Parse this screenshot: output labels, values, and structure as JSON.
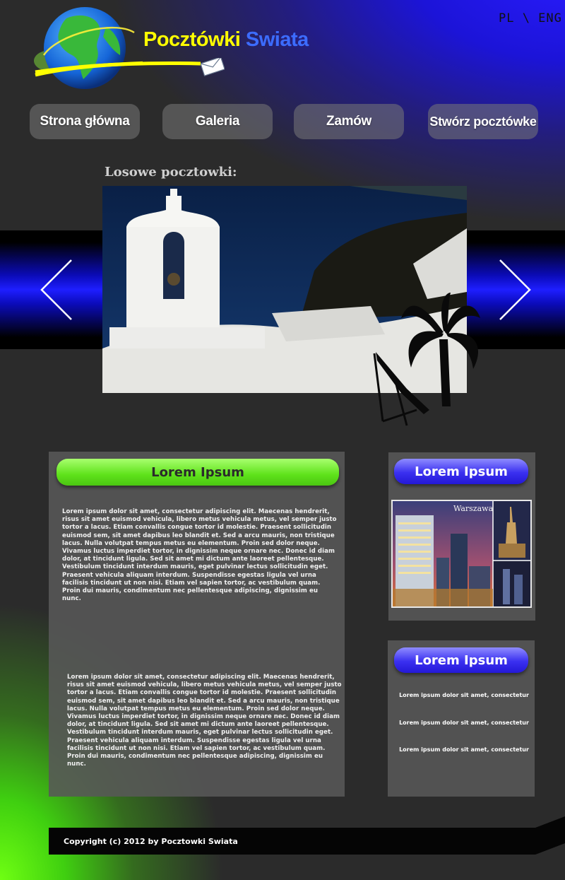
{
  "header": {
    "lang_switch": "PL \\ ENG",
    "title_part1": "Pocztówki",
    "title_part2": "Swiata",
    "logo_icon": "globe-with-envelope-icon"
  },
  "nav": {
    "items": [
      {
        "label": "Strona główna"
      },
      {
        "label": "Galeria"
      },
      {
        "label": "Zamów"
      },
      {
        "label": "Stwórz pocztówke"
      }
    ]
  },
  "slider": {
    "heading": "Losowe pocztowki:",
    "image": "santorini-bell-tower-photo",
    "prev_icon": "chevron-left-icon",
    "next_icon": "chevron-right-icon"
  },
  "main": {
    "heading": "Lorem Ipsum",
    "paragraph1": "Lorem ipsum dolor sit amet, consectetur adipiscing elit. Maecenas hendrerit, risus sit amet euismod vehicula, libero metus vehicula metus, vel semper justo tortor a lacus. Etiam convallis congue tortor id molestie. Praesent sollicitudin euismod sem, sit amet dapibus leo blandit et. Sed a arcu mauris, non tristique lacus. Nulla volutpat tempus metus eu elementum. Proin sed dolor neque. Vivamus luctus imperdiet tortor, in dignissim neque ornare nec. Donec id diam dolor, at tincidunt ligula. Sed sit amet mi dictum ante laoreet pellentesque. Vestibulum tincidunt interdum mauris, eget pulvinar lectus sollicitudin eget. Praesent vehicula aliquam interdum. Suspendisse egestas ligula vel urna facilisis tincidunt ut non nisi. Etiam vel sapien tortor, ac vestibulum quam. Proin dui mauris, condimentum nec pellentesque adipiscing, dignissim eu nunc.",
    "paragraph2": "Lorem ipsum dolor sit amet, consectetur adipiscing elit. Maecenas hendrerit, risus sit amet euismod vehicula, libero metus vehicula metus, vel semper justo tortor a lacus. Etiam convallis congue tortor id molestie. Praesent sollicitudin euismod sem, sit amet dapibus leo blandit et. Sed a arcu mauris, non tristique lacus. Nulla volutpat tempus metus eu elementum. Proin sed dolor neque. Vivamus luctus imperdiet tortor, in dignissim neque ornare nec. Donec id diam dolor, at tincidunt ligula. Sed sit amet mi dictum ante laoreet pellentesque. Vestibulum tincidunt interdum mauris, eget pulvinar lectus sollicitudin eget. Praesent vehicula aliquam interdum. Suspendisse egestas ligula vel urna facilisis tincidunt ut non nisi. Etiam vel sapien tortor, ac vestibulum quam. Proin dui mauris, condimentum nec pellentesque adipiscing, dignissim eu nunc."
  },
  "sidebar": {
    "box1_heading": "Lorem Ipsum",
    "box1_photo_caption": "Warszawa",
    "box2_heading": "Lorem Ipsum",
    "box2_lines": [
      "Lorem ipsum dolor sit amet, consectetur",
      "Lorem ipsum dolor sit amet, consectetur",
      "Lorem ipsum dolor sit amet, consectetur"
    ]
  },
  "footer": {
    "copyright": "Copyright (c) 2012 by Pocztowki Swiata"
  },
  "colors": {
    "accent_green": "#5ee21a",
    "accent_blue": "#2418d6",
    "title_yellow": "#ffff00",
    "title_blue": "#3c6cff"
  }
}
